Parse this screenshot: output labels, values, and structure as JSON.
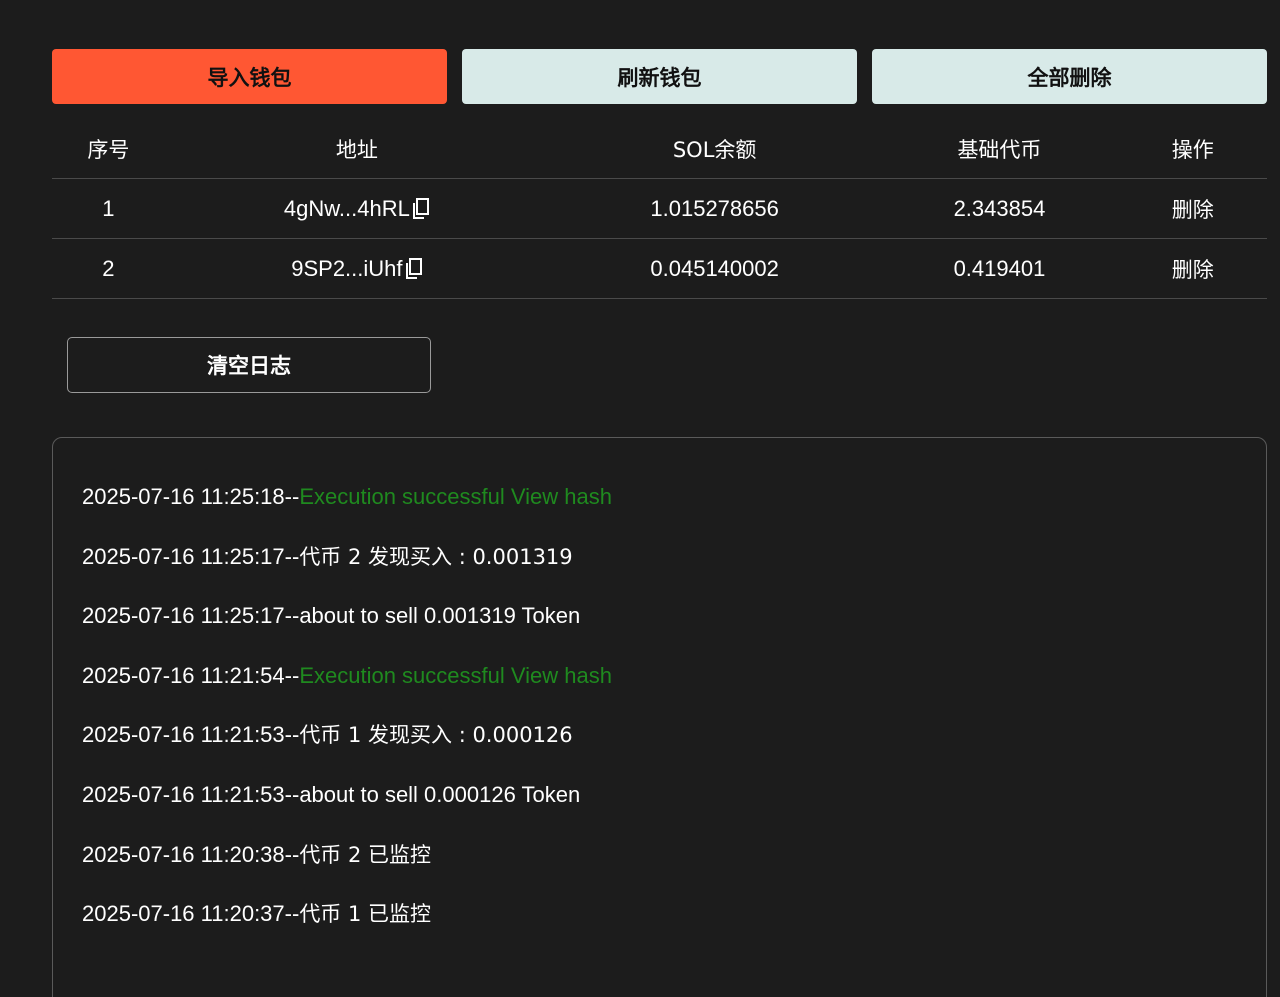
{
  "toolbar": {
    "import_label": "导入钱包",
    "refresh_label": "刷新钱包",
    "delete_all_label": "全部删除"
  },
  "table": {
    "headers": [
      "序号",
      "地址",
      "SOL余额",
      "基础代币",
      "操作"
    ],
    "rows": [
      {
        "index": "1",
        "address": "4gNw...4hRL",
        "sol": "1.015278656",
        "base": "2.343854",
        "action": "删除"
      },
      {
        "index": "2",
        "address": "9SP2...iUhf",
        "sol": "0.045140002",
        "base": "0.419401",
        "action": "删除"
      }
    ]
  },
  "clear_log_label": "清空日志",
  "logs": [
    {
      "time": "2025-07-16 11:25:18--",
      "text": "",
      "link": "Execution successful View hash"
    },
    {
      "time": "2025-07-16 11:25:17--",
      "text": "代币 2 发现买入 : 0.001319",
      "link": ""
    },
    {
      "time": "2025-07-16 11:25:17--",
      "text": "about to sell 0.001319 Token",
      "link": ""
    },
    {
      "time": "2025-07-16 11:21:54--",
      "text": "",
      "link": "Execution successful View hash"
    },
    {
      "time": "2025-07-16 11:21:53--",
      "text": "代币 1 发现买入 : 0.000126",
      "link": ""
    },
    {
      "time": "2025-07-16 11:21:53--",
      "text": "about to sell 0.000126 Token",
      "link": ""
    },
    {
      "time": "2025-07-16 11:20:38--",
      "text": "代币 2 已监控",
      "link": ""
    },
    {
      "time": "2025-07-16 11:20:37--",
      "text": "代币 1 已监控",
      "link": ""
    }
  ],
  "colors": {
    "background": "#1c1c1c",
    "primary_button": "#ff5733",
    "light_button": "#d8eae8",
    "success_text": "#1f8a1f"
  },
  "icons": {
    "copy": "copy-icon"
  }
}
